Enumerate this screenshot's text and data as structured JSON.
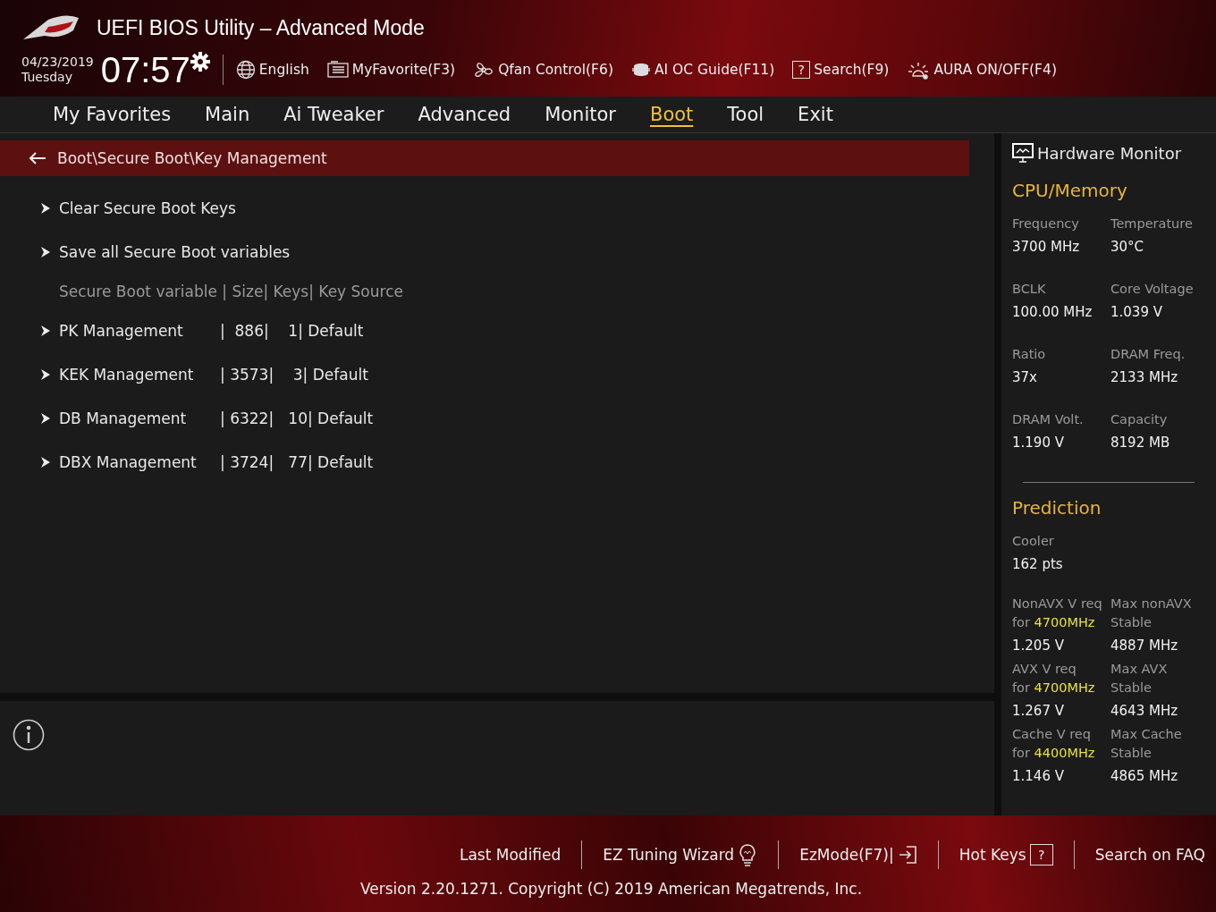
{
  "header": {
    "title": "UEFI BIOS Utility – Advanced Mode",
    "date": "04/23/2019",
    "day": "Tuesday",
    "time": "07:57",
    "tools": [
      {
        "kind": "language",
        "label": "English"
      },
      {
        "kind": "favorite",
        "label": "MyFavorite(F3)"
      },
      {
        "kind": "fan",
        "label": "Qfan Control(F6)"
      },
      {
        "kind": "guide",
        "label": "AI OC Guide(F11)"
      },
      {
        "kind": "search",
        "label": "Search(F9)",
        "glyph": "?"
      },
      {
        "kind": "aura",
        "label": "AURA ON/OFF(F4)"
      }
    ]
  },
  "tabs": [
    {
      "label": "My Favorites",
      "selected": false
    },
    {
      "label": "Main",
      "selected": false
    },
    {
      "label": "Ai Tweaker",
      "selected": false
    },
    {
      "label": "Advanced",
      "selected": false
    },
    {
      "label": "Monitor",
      "selected": false
    },
    {
      "label": "Boot",
      "selected": true
    },
    {
      "label": "Tool",
      "selected": false
    },
    {
      "label": "Exit",
      "selected": false
    }
  ],
  "breadcrumb": "Boot\\Secure Boot\\Key Management",
  "items": [
    {
      "kind": "submenu",
      "label": "Clear Secure Boot Keys"
    },
    {
      "kind": "submenu",
      "label": "Save all Secure Boot variables"
    },
    {
      "kind": "heading",
      "label": "Secure Boot variable | Size| Keys| Key Source"
    },
    {
      "kind": "submenu",
      "label": "PK Management",
      "details": "|  886|    1| Default"
    },
    {
      "kind": "submenu",
      "label": "KEK Management",
      "details": "| 3573|    3| Default"
    },
    {
      "kind": "submenu",
      "label": "DB Management",
      "details": "| 6322|   10| Default"
    },
    {
      "kind": "submenu",
      "label": "DBX Management",
      "details": "| 3724|   77| Default"
    }
  ],
  "hardware_monitor": {
    "title": "Hardware Monitor",
    "sections": [
      {
        "title": "CPU/Memory",
        "stats": [
          {
            "label": "Frequency",
            "value": "3700 MHz"
          },
          {
            "label": "Temperature",
            "value": "30°C"
          },
          {
            "label": "BCLK",
            "value": "100.00 MHz"
          },
          {
            "label": "Core Voltage",
            "value": "1.039 V"
          },
          {
            "label": "Ratio",
            "value": "37x"
          },
          {
            "label": "DRAM Freq.",
            "value": "2133 MHz"
          },
          {
            "label": "DRAM Volt.",
            "value": "1.190 V"
          },
          {
            "label": "Capacity",
            "value": "8192 MB"
          }
        ]
      },
      {
        "title": "Prediction",
        "cooler": {
          "label": "Cooler",
          "value": "162 pts"
        },
        "predictions": [
          {
            "label": "NonAVX V req",
            "prefix": "for",
            "freq": "4700MHz",
            "value": "1.205 V",
            "max_label": "Max nonAVX",
            "max_sub": "Stable",
            "max_value": "4887 MHz"
          },
          {
            "label": "AVX V req",
            "prefix": "for",
            "freq": "4700MHz",
            "value": "1.267 V",
            "max_label": "Max AVX",
            "max_sub": "Stable",
            "max_value": "4643 MHz"
          },
          {
            "label": "Cache V req",
            "prefix": "for",
            "freq": "4400MHz",
            "value": "1.146 V",
            "max_label": "Max Cache",
            "max_sub": "Stable",
            "max_value": "4865 MHz"
          }
        ]
      }
    ]
  },
  "footer": {
    "links": [
      {
        "kind": "plain",
        "label": "Last Modified"
      },
      {
        "kind": "wizard",
        "label": "EZ Tuning Wizard"
      },
      {
        "kind": "ezmode",
        "label": "EzMode(F7)|"
      },
      {
        "kind": "hotkeys",
        "label": "Hot Keys",
        "glyph": "?"
      },
      {
        "kind": "plain",
        "label": "Search on FAQ"
      }
    ],
    "version": "Version 2.20.1271. Copyright (C) 2019 American Megatrends, Inc."
  }
}
